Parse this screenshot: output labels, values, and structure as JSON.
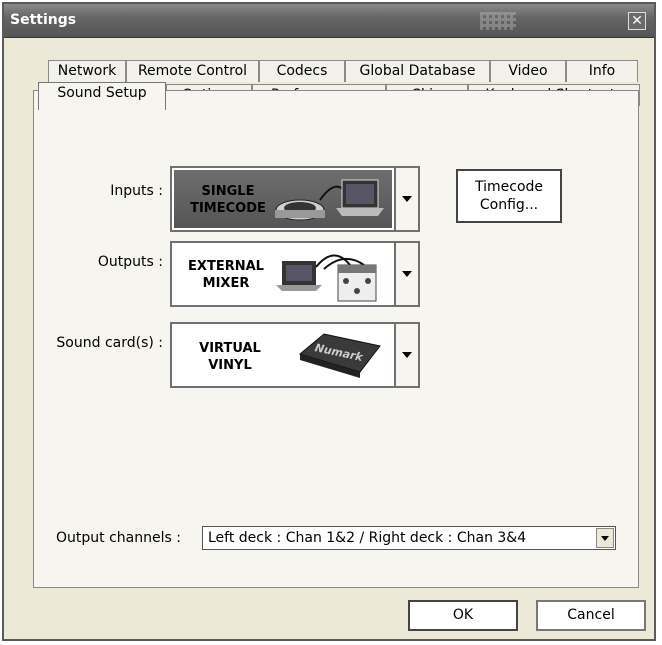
{
  "window": {
    "title": "Settings",
    "close_icon": "close-icon"
  },
  "tabs_row1": [
    "Network",
    "Remote Control",
    "Codecs",
    "Global Database",
    "Video",
    "Info"
  ],
  "tabs_row2": [
    "Sound Setup",
    "Options",
    "Performances",
    "Skin",
    "Keyboard Shortcuts"
  ],
  "active_tab": "Sound Setup",
  "inputs": {
    "label": "Inputs :",
    "value_line1": "SINGLE",
    "value_line2": "TIMECODE"
  },
  "outputs": {
    "label": "Outputs :",
    "value_line1": "EXTERNAL",
    "value_line2": "MIXER"
  },
  "soundcard": {
    "label": "Sound card(s) :",
    "value_line1": "VIRTUAL",
    "value_line2": "VINYL",
    "device_brand": "Numark"
  },
  "timecode_button": {
    "line1": "Timecode",
    "line2": "Config..."
  },
  "output_channels": {
    "label": "Output channels :",
    "value": "Left deck : Chan 1&2 / Right deck : Chan 3&4"
  },
  "buttons": {
    "ok": "OK",
    "cancel": "Cancel"
  },
  "colors": {
    "titlebar": "#666666",
    "dialog_bg": "#ece9d8",
    "panel_bg": "#f6f5ef"
  }
}
